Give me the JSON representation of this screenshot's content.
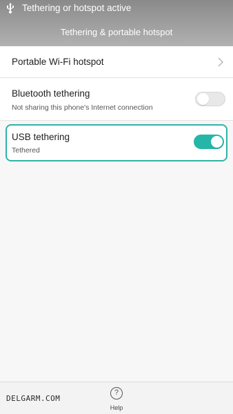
{
  "status_bar": {
    "notification_icon": "usb-icon",
    "notification_text": "Tethering or hotspot active"
  },
  "header": {
    "title": "Tethering & portable hotspot"
  },
  "settings": {
    "wifi_hotspot": {
      "title": "Portable Wi-Fi hotspot",
      "icon": "chevron-right-icon"
    },
    "bluetooth": {
      "title": "Bluetooth tethering",
      "subtitle": "Not sharing this phone's Internet connection",
      "enabled": false
    },
    "usb": {
      "title": "USB tethering",
      "subtitle": "Tethered",
      "enabled": true
    }
  },
  "bottom_bar": {
    "help_label": "Help",
    "help_icon": "question-circle-icon"
  },
  "watermark": "DELGARM.COM",
  "colors": {
    "accent": "#26b6a8",
    "highlight_border": "#2fb3a5",
    "header_top": "#8a8a8a",
    "header_bottom": "#b1b1b1"
  }
}
